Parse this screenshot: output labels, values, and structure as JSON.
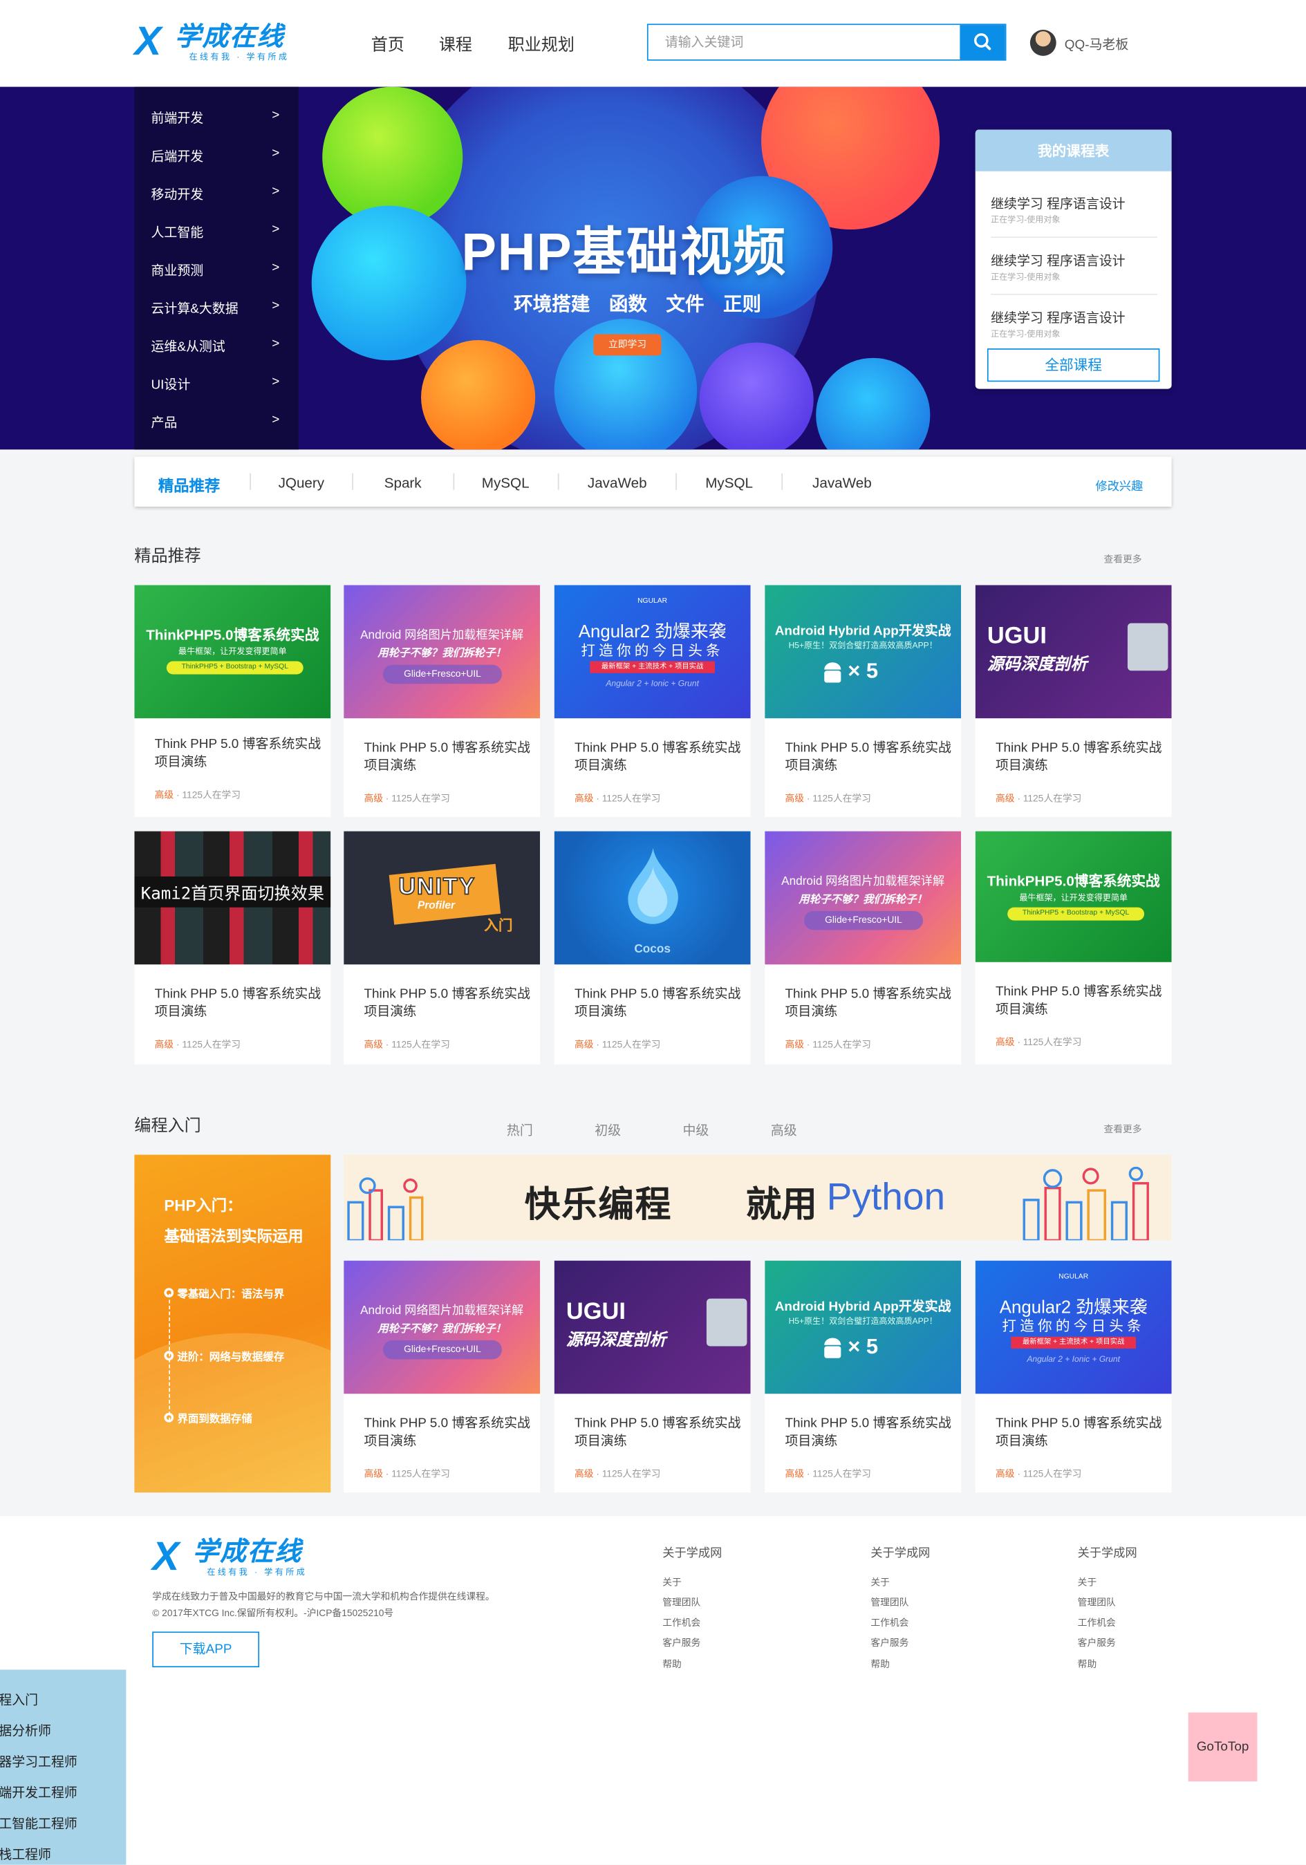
{
  "header": {
    "logo_text": "学成在线",
    "logo_slogan": "在线有我 · 学有所成",
    "nav": [
      "首页",
      "课程",
      "职业规划"
    ],
    "search_placeholder": "请输入关键词",
    "user_name": "QQ-马老板"
  },
  "categories": [
    {
      "label": "前端开发",
      "arrow": ">"
    },
    {
      "label": "后端开发",
      "arrow": ">"
    },
    {
      "label": "移动开发",
      "arrow": ">"
    },
    {
      "label": "人工智能",
      "arrow": ">"
    },
    {
      "label": "商业预测",
      "arrow": ">"
    },
    {
      "label": "云计算&大数据",
      "arrow": ">"
    },
    {
      "label": "运维&从测试",
      "arrow": ">"
    },
    {
      "label": "UI设计",
      "arrow": ">"
    },
    {
      "label": "产品",
      "arrow": ">"
    }
  ],
  "banner": {
    "title": "PHP基础视频",
    "subtitle": "环境搭建　函数　文件　正则",
    "button": "立即学习"
  },
  "course_panel": {
    "title": "我的课程表",
    "items": [
      {
        "title": "继续学习 程序语言设计",
        "sub": "正在学习-使用对象"
      },
      {
        "title": "继续学习 程序语言设计",
        "sub": "正在学习-使用对象"
      },
      {
        "title": "继续学习 程序语言设计",
        "sub": "正在学习-使用对象"
      }
    ],
    "all_button": "全部课程"
  },
  "tagbar": {
    "main": "精品推荐",
    "tags": [
      "JQuery",
      "Spark",
      "MySQL",
      "JavaWeb",
      "MySQL",
      "JavaWeb"
    ],
    "edit": "修改兴趣"
  },
  "featured": {
    "title": "精品推荐",
    "more": "查看更多",
    "cards": [
      {
        "img_title": "ThinkPHP5.0博客系统实战",
        "img_sub": "最牛框架，让开发变得更简单",
        "img_tag": "ThinkPHP5 + Bootstrap + MySQL",
        "title": "Think PHP 5.0 博客系统实战项目演练",
        "level": "高级",
        "students": "1125人在学习"
      },
      {
        "img_title": "Android 网络图片加载框架详解",
        "img_sub": "用轮子不够？我们拆轮子！",
        "img_tag": "Glide+Fresco+UIL",
        "title": "Think PHP 5.0 博客系统实战项目演练",
        "level": "高级",
        "students": "1125人在学习"
      },
      {
        "img_title": "Angular2 劲爆来袭",
        "img_sub": "打造你的今日头条",
        "img_tag": "最新框架 + 主流技术 + 项目实战",
        "img_extra": "Angular 2 + Ionic + Grunt",
        "img_brand": "NGULAR",
        "title": "Think PHP 5.0 博客系统实战项目演练",
        "level": "高级",
        "students": "1125人在学习"
      },
      {
        "img_title": "Android Hybrid App开发实战",
        "img_sub": "H5+原生！双剑合璧打造高效高质APP！",
        "img_tag": "× 5",
        "title": "Think PHP 5.0 博客系统实战项目演练",
        "level": "高级",
        "students": "1125人在学习"
      },
      {
        "img_title": "UGUI",
        "img_sub": "源码深度剖析",
        "title": "Think PHP 5.0 博客系统实战项目演练",
        "level": "高级",
        "students": "1125人在学习"
      },
      {
        "img_title": "Kami2首页界面切换效果",
        "title": "Think PHP 5.0 博客系统实战项目演练",
        "level": "高级",
        "students": "1125人在学习"
      },
      {
        "img_title": "UNITY",
        "img_sub": "Profiler",
        "img_tag": "入门",
        "title": "Think PHP 5.0 博客系统实战项目演练",
        "level": "高级",
        "students": "1125人在学习"
      },
      {
        "img_title": "Cocos",
        "title": "Think PHP 5.0 博客系统实战项目演练",
        "level": "高级",
        "students": "1125人在学习"
      },
      {
        "img_title": "Android 网络图片加载框架详解",
        "img_sub": "用轮子不够？我们拆轮子！",
        "img_tag": "Glide+Fresco+UIL",
        "title": "Think PHP 5.0 博客系统实战项目演练",
        "level": "高级",
        "students": "1125人在学习"
      },
      {
        "img_title": "ThinkPHP5.0博客系统实战",
        "img_sub": "最牛框架，让开发变得更简单",
        "img_tag": "ThinkPHP5 + Bootstrap + MySQL",
        "title": "Think PHP 5.0 博客系统实战项目演练",
        "level": "高级",
        "students": "1125人在学习"
      }
    ]
  },
  "programming": {
    "title": "编程入门",
    "tabs": [
      "热门",
      "初级",
      "中级",
      "高级"
    ],
    "more": "查看更多",
    "side": {
      "title": "PHP入门：",
      "subtitle": "基础语法到实际运用",
      "steps": [
        "零基础入门：语法与界",
        "进阶：网络与数据缓存",
        "界面到数据存储"
      ]
    },
    "banner": {
      "text1": "快乐编程",
      "text2": "就用",
      "text3": "Python"
    },
    "cards": [
      {
        "img_title": "Android 网络图片加载框架详解",
        "img_sub": "用轮子不够？我们拆轮子！",
        "img_tag": "Glide+Fresco+UIL",
        "title": "Think PHP 5.0 博客系统实战项目演练",
        "level": "高级",
        "students": "1125人在学习"
      },
      {
        "img_title": "UGUI",
        "img_sub": "源码深度剖析",
        "title": "Think PHP 5.0 博客系统实战项目演练",
        "level": "高级",
        "students": "1125人在学习"
      },
      {
        "img_title": "Android Hybrid App开发实战",
        "img_sub": "H5+原生！双剑合璧打造高效高质APP！",
        "img_tag": "× 5",
        "title": "Think PHP 5.0 博客系统实战项目演练",
        "level": "高级",
        "students": "1125人在学习"
      },
      {
        "img_title": "Angular2 劲爆来袭",
        "img_sub": "打造你的今日头条",
        "img_tag": "最新框架 + 主流技术 + 项目实战",
        "img_extra": "Angular 2 + Ionic + Grunt",
        "img_brand": "NGULAR",
        "title": "Think PHP 5.0 博客系统实战项目演练",
        "level": "高级",
        "students": "1125人在学习"
      }
    ]
  },
  "footer": {
    "desc_line1": "学成在线致力于普及中国最好的教育它与中国一流大学和机构合作提供在线课程。",
    "desc_line2": "© 2017年XTCG Inc.保留所有权利。-沪ICP备15025210号",
    "download": "下载APP",
    "columns": [
      {
        "title": "关于学成网",
        "links": [
          "关于",
          "管理团队",
          "工作机会",
          "客户服务",
          "帮助"
        ]
      },
      {
        "title": "关于学成网",
        "links": [
          "关于",
          "管理团队",
          "工作机会",
          "客户服务",
          "帮助"
        ]
      },
      {
        "title": "关于学成网",
        "links": [
          "关于",
          "管理团队",
          "工作机会",
          "客户服务",
          "帮助"
        ]
      }
    ]
  },
  "side_panel": {
    "items": [
      "程入门",
      "据分析师",
      "器学习工程师",
      "端开发工程师",
      "工智能工程师",
      "栈工程师"
    ]
  },
  "gototop": "GoToTop",
  "colors": {
    "primary": "#0b8ee8",
    "level": "#f26b2a",
    "banner_bg": "#1a0a6b",
    "side_panel": "#a8d4ea",
    "gototop": "#ffc0cb"
  }
}
